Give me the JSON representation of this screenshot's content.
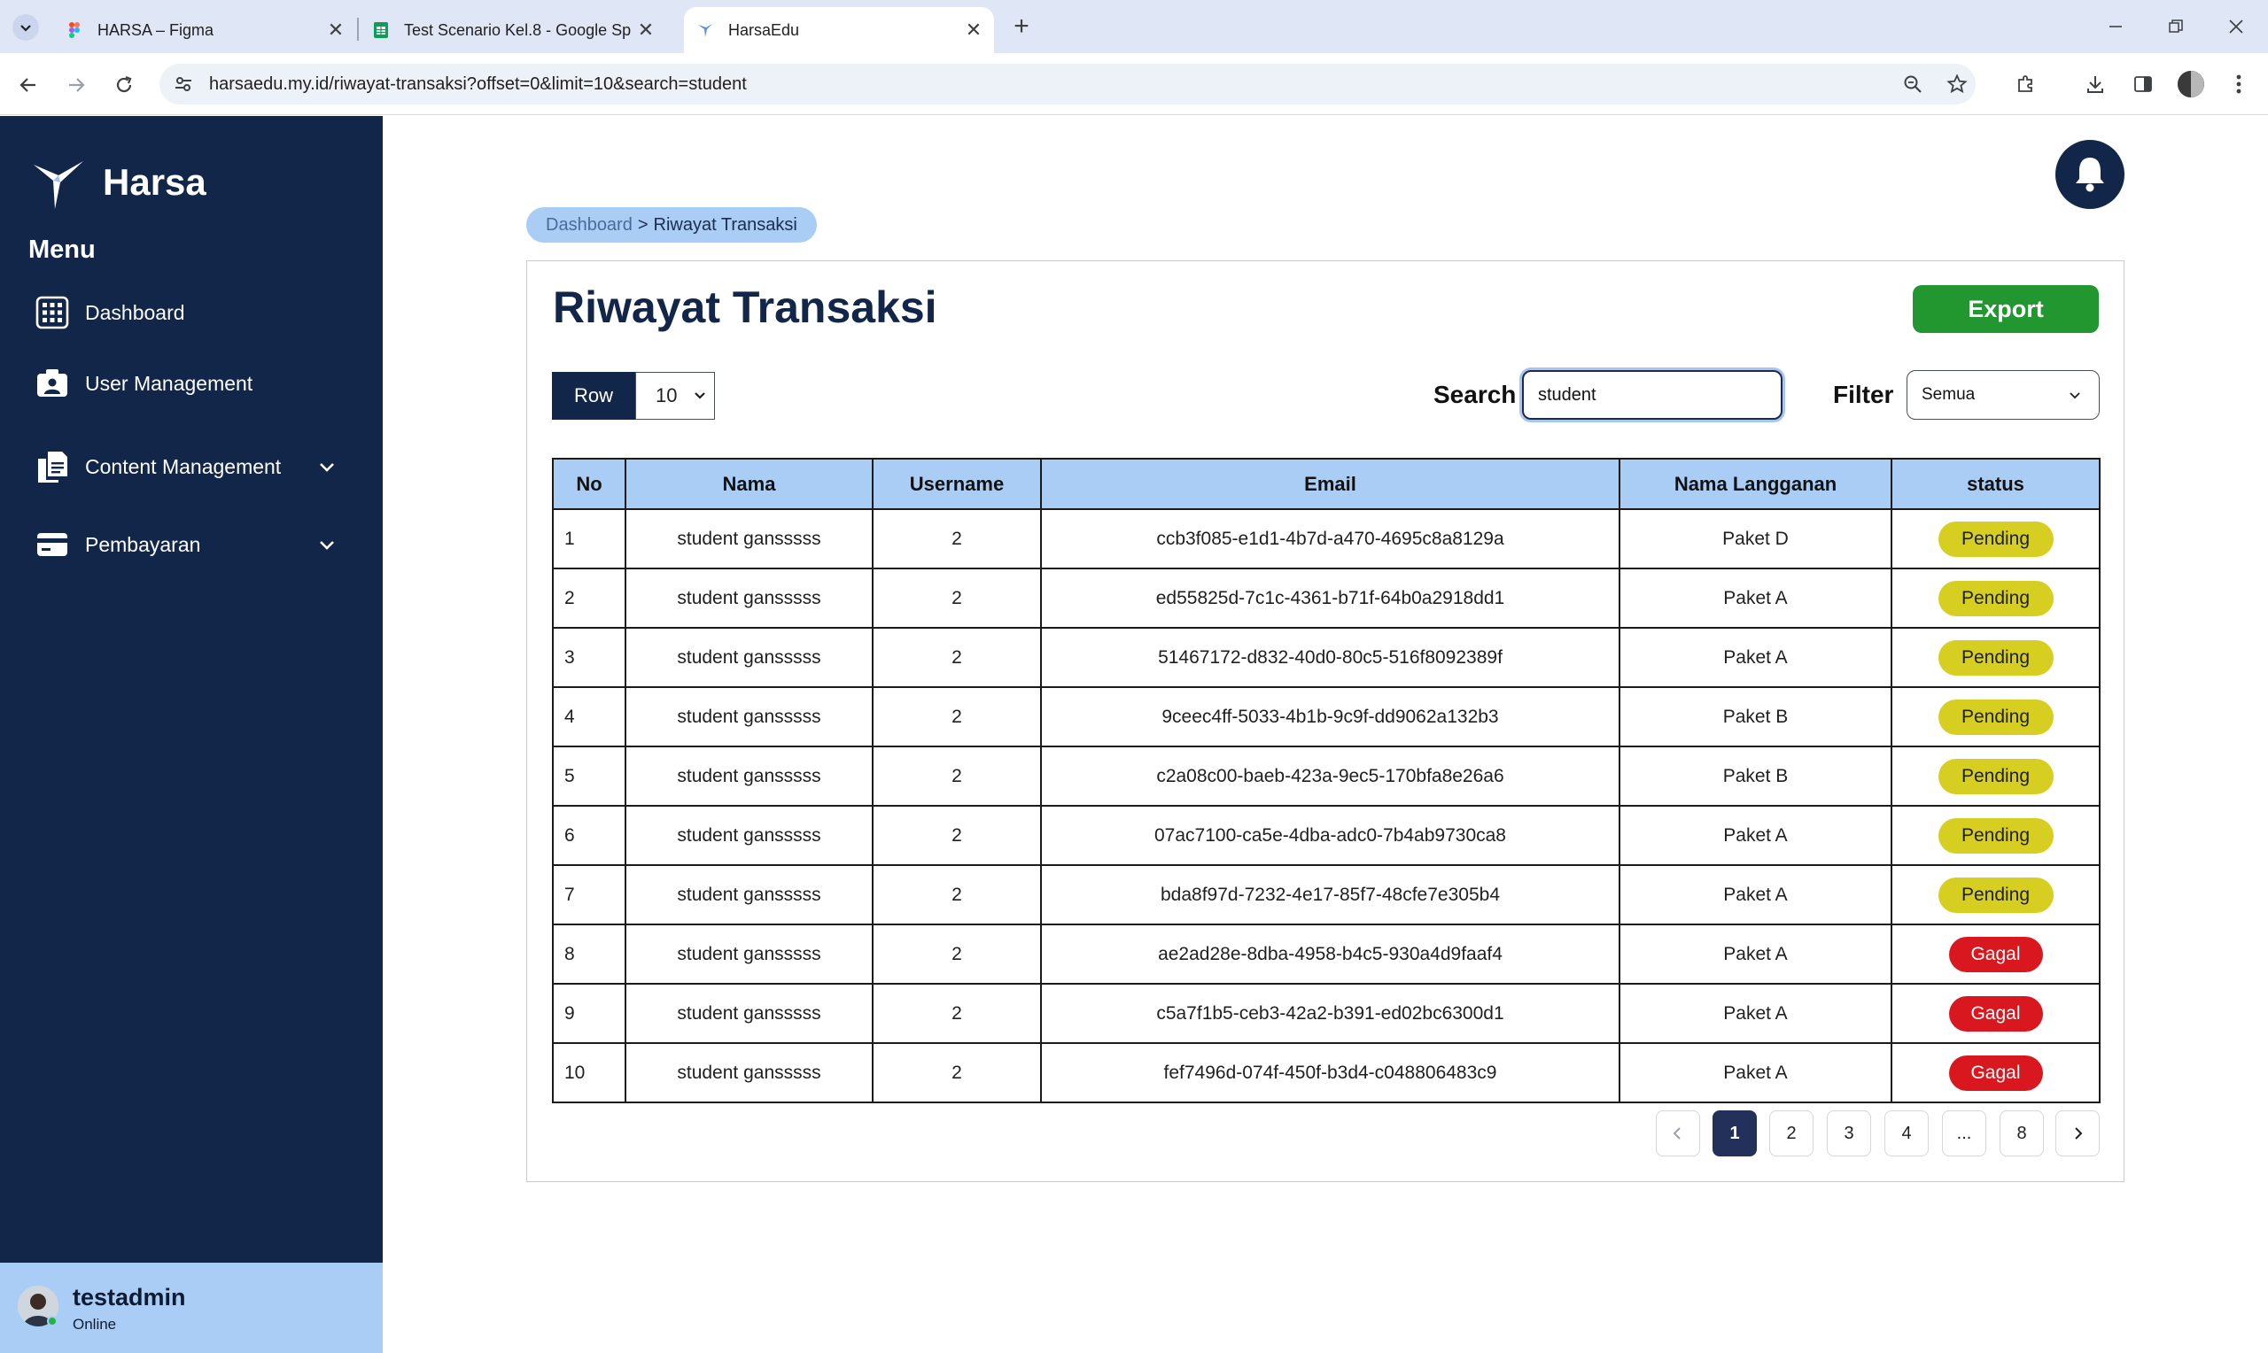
{
  "browser": {
    "tabs": [
      {
        "title": "HARSA – Figma"
      },
      {
        "title": "Test Scenario Kel.8 - Google Sp"
      },
      {
        "title": "HarsaEdu"
      }
    ],
    "new_tab": "+",
    "url": "harsaedu.my.id/riwayat-transaksi?offset=0&limit=10&search=student"
  },
  "sidebar": {
    "brand": "Harsa",
    "menu_heading": "Menu",
    "items": [
      {
        "label": "Dashboard",
        "icon": "dashboard-grid-icon"
      },
      {
        "label": "User Management",
        "icon": "user-card-icon"
      },
      {
        "label": "Content Management",
        "icon": "documents-icon"
      },
      {
        "label": "Pembayaran",
        "icon": "payment-card-icon"
      }
    ],
    "user": {
      "name": "testadmin",
      "status": "Online"
    }
  },
  "breadcrumb": {
    "root": "Dashboard",
    "separator": ">",
    "current": "Riwayat Transaksi"
  },
  "page": {
    "title": "Riwayat Transaksi",
    "export_label": "Export",
    "row_label": "Row",
    "row_value": "10",
    "search_label": "Search",
    "search_value": "student",
    "filter_label": "Filter",
    "filter_value": "Semua"
  },
  "table": {
    "headers": [
      "No",
      "Nama",
      "Username",
      "Email",
      "Nama Langganan",
      "status"
    ],
    "rows": [
      {
        "no": "1",
        "nama": "student gansssss",
        "username": "2",
        "email": "ccb3f085-e1d1-4b7d-a470-4695c8a8129a",
        "langganan": "Paket D",
        "status": "Pending"
      },
      {
        "no": "2",
        "nama": "student gansssss",
        "username": "2",
        "email": "ed55825d-7c1c-4361-b71f-64b0a2918dd1",
        "langganan": "Paket A",
        "status": "Pending"
      },
      {
        "no": "3",
        "nama": "student gansssss",
        "username": "2",
        "email": "51467172-d832-40d0-80c5-516f8092389f",
        "langganan": "Paket A",
        "status": "Pending"
      },
      {
        "no": "4",
        "nama": "student gansssss",
        "username": "2",
        "email": "9ceec4ff-5033-4b1b-9c9f-dd9062a132b3",
        "langganan": "Paket B",
        "status": "Pending"
      },
      {
        "no": "5",
        "nama": "student gansssss",
        "username": "2",
        "email": "c2a08c00-baeb-423a-9ec5-170bfa8e26a6",
        "langganan": "Paket B",
        "status": "Pending"
      },
      {
        "no": "6",
        "nama": "student gansssss",
        "username": "2",
        "email": "07ac7100-ca5e-4dba-adc0-7b4ab9730ca8",
        "langganan": "Paket A",
        "status": "Pending"
      },
      {
        "no": "7",
        "nama": "student gansssss",
        "username": "2",
        "email": "bda8f97d-7232-4e17-85f7-48cfe7e305b4",
        "langganan": "Paket A",
        "status": "Pending"
      },
      {
        "no": "8",
        "nama": "student gansssss",
        "username": "2",
        "email": "ae2ad28e-8dba-4958-b4c5-930a4d9faaf4",
        "langganan": "Paket A",
        "status": "Gagal"
      },
      {
        "no": "9",
        "nama": "student gansssss",
        "username": "2",
        "email": "c5a7f1b5-ceb3-42a2-b391-ed02bc6300d1",
        "langganan": "Paket A",
        "status": "Gagal"
      },
      {
        "no": "10",
        "nama": "student gansssss",
        "username": "2",
        "email": "fef7496d-074f-450f-b3d4-c048806483c9",
        "langganan": "Paket A",
        "status": "Gagal"
      }
    ]
  },
  "pagination": {
    "pages": [
      "1",
      "2",
      "3",
      "4",
      "...",
      "8"
    ],
    "current": "1"
  },
  "colors": {
    "sidebar_bg": "#12264a",
    "accent_light": "#a9cdf5",
    "export_green": "#22972f",
    "pending_yellow": "#d6cf22",
    "gagal_red": "#d9171e"
  }
}
